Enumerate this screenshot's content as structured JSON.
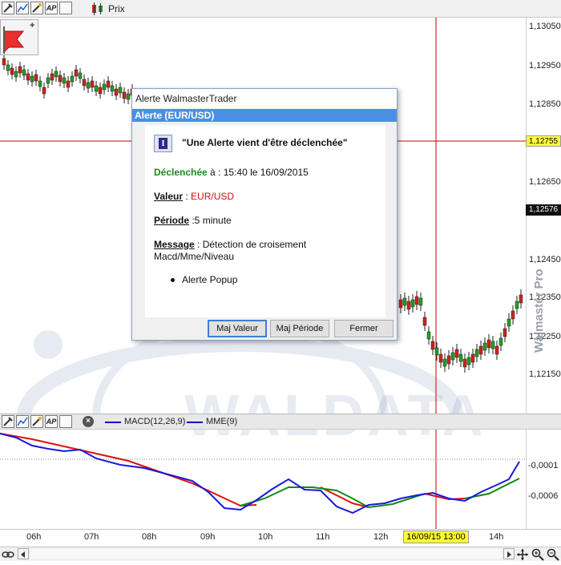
{
  "toolbar": {
    "icons": [
      "tools-icon",
      "indicator-icon",
      "wizard-icon",
      "ap-icon",
      "window-icon",
      "candles-icon"
    ],
    "ap_label": "AP",
    "series_label": "Prix"
  },
  "price_axis": {
    "ticks": [
      "1,13050",
      "1,12950",
      "1,12850",
      "1,12650",
      "1,12450",
      "1,12350",
      "1,12250",
      "1,12150"
    ],
    "crosshair_price": "1,12755",
    "last_price": "1,12576"
  },
  "watermark": {
    "brand": "WALDATA",
    "vertical": "Walmaster Pro"
  },
  "time_axis": {
    "ticks": [
      "06h",
      "07h",
      "08h",
      "09h",
      "10h",
      "11h",
      "12h",
      "14h"
    ],
    "cursor_label": "16/09/15 13:00"
  },
  "indicator_panel": {
    "legend": [
      {
        "name": "MACD(12,26,9)",
        "color": "#0000cc"
      },
      {
        "name": "MME(9)",
        "color": "#0000cc"
      }
    ],
    "axis_ticks": [
      "-0,0001",
      "-0,0006"
    ]
  },
  "colors": {
    "up_candle": "#22a022",
    "down_candle": "#cc2222",
    "macd_line": "#1a1ad8",
    "signal_above": "#e01010",
    "signal_below": "#138a13",
    "crosshair": "#cc0000",
    "dialog_bar": "#4a90e2"
  },
  "dialog": {
    "window_title": "Alerte WalmasterTrader",
    "header": "Alerte (EUR/USD)",
    "info_icon_glyph": "I",
    "headline": "\"Une Alerte vient d'être déclenchée\"",
    "triggered_label": "Déclenchée",
    "triggered_value": " à : 15:40 le 16/09/2015",
    "value_label": "Valeur",
    "value_sep": " : ",
    "value": "EUR/USD",
    "period_label": "Période",
    "period_value": " :5 minute",
    "message_label": "Message",
    "message_line1": " : Détection de croisement",
    "message_line2": "Macd/Mme/Niveau",
    "bullet": "Alerte Popup",
    "buttons": [
      "Maj Valeur",
      "Maj Période",
      "Fermer"
    ]
  }
}
